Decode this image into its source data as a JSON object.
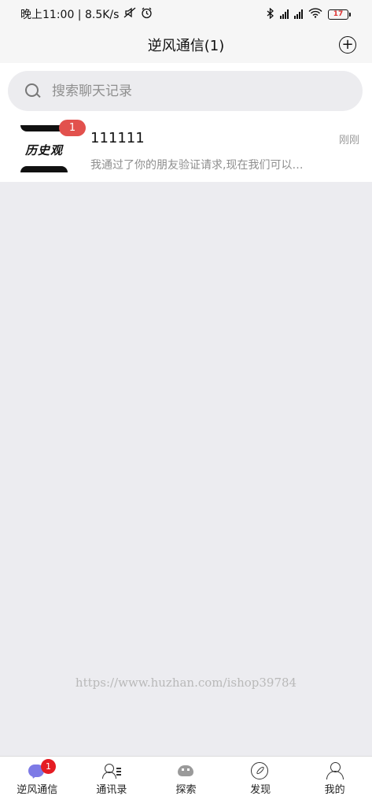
{
  "status_bar": {
    "time_and_speed": "晚上11:00 | 8.5K/s",
    "battery_level": "17"
  },
  "header": {
    "title": "逆风通信(1)",
    "add_icon": "plus-circle-icon"
  },
  "search": {
    "placeholder": "搜索聊天记录"
  },
  "chats": [
    {
      "avatar_text": "历史观",
      "unread_count": "1",
      "name": "111111",
      "time": "刚刚",
      "preview": "我通过了你的朋友验证请求,现在我们可以…"
    }
  ],
  "watermark": "https://www.huzhan.com/ishop39784",
  "tab_bar": {
    "badge": "1",
    "tabs": [
      {
        "label": "逆风通信",
        "icon": "chat-bubble-icon"
      },
      {
        "label": "通讯录",
        "icon": "contacts-icon"
      },
      {
        "label": "探索",
        "icon": "explore-icon"
      },
      {
        "label": "发现",
        "icon": "discover-icon"
      },
      {
        "label": "我的",
        "icon": "profile-icon"
      }
    ]
  },
  "colors": {
    "badge_red": "#e2514d",
    "tab_badge_red": "#e51c23",
    "chat_icon_purple": "#7d7ae6",
    "background": "#ececf0"
  }
}
